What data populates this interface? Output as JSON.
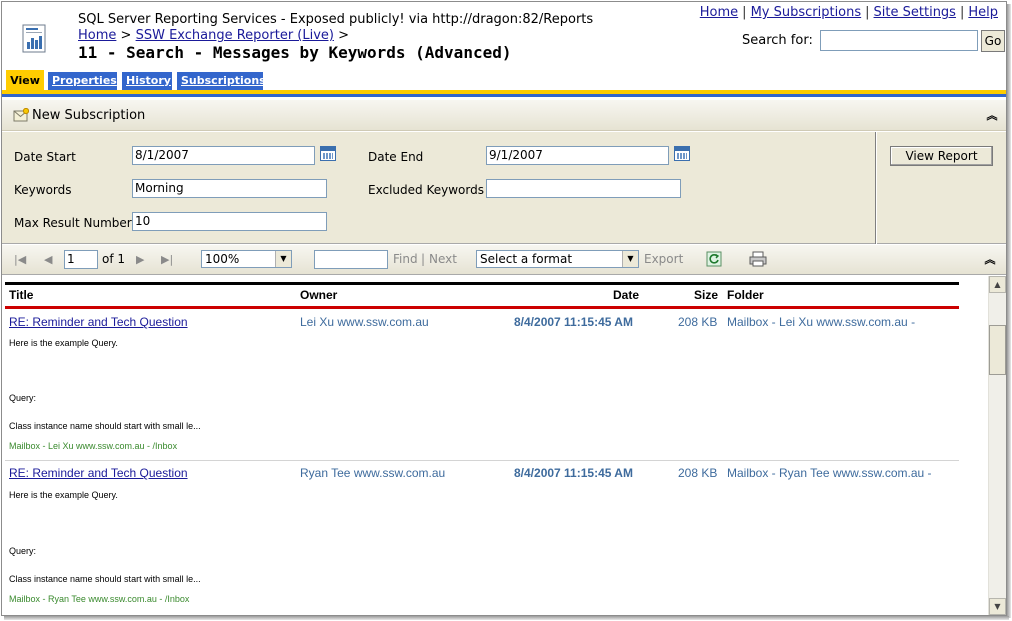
{
  "header": {
    "site_title": "SQL Server Reporting Services - Exposed publicly! via http://dragon:82/Reports",
    "breadcrumb_home": "Home",
    "breadcrumb_sep": ">",
    "breadcrumb_folder": "SSW Exchange Reporter (Live)",
    "breadcrumb_trailing": ">",
    "page_title": "11 - Search - Messages by Keywords (Advanced)",
    "top_links": {
      "home": "Home",
      "my_subscriptions": "My Subscriptions",
      "site_settings": "Site Settings",
      "help": "Help",
      "separator": "|"
    },
    "search_label": "Search for:",
    "search_value": "",
    "go_label": "Go"
  },
  "tabs": [
    {
      "label": "View",
      "active": true
    },
    {
      "label": "Properties",
      "active": false
    },
    {
      "label": "History",
      "active": false
    },
    {
      "label": "Subscriptions",
      "active": false
    }
  ],
  "subscription_bar": {
    "new_subscription_label": "New Subscription",
    "collapse_icon": "double-chevron-up-icon"
  },
  "parameters": {
    "date_start_label": "Date Start",
    "date_start_value": "8/1/2007",
    "date_end_label": "Date End",
    "date_end_value": "9/1/2007",
    "keywords_label": "Keywords",
    "keywords_value": "Morning",
    "excluded_keywords_label": "Excluded Keywords",
    "excluded_keywords_value": "",
    "max_result_label": "Max Result Number",
    "max_result_value": "10",
    "view_report_label": "View Report"
  },
  "toolbar": {
    "page_value": "1",
    "page_of": "of 1",
    "zoom_value": "100%",
    "find_value": "",
    "find_label": "Find",
    "find_separator": "|",
    "next_label": "Next",
    "format_value": "Select a format",
    "export_label": "Export"
  },
  "report": {
    "columns": {
      "title": "Title",
      "owner": "Owner",
      "date": "Date",
      "size": "Size",
      "folder": "Folder"
    },
    "records": [
      {
        "title": "RE: Reminder and Tech Question",
        "owner": "Lei Xu www.ssw.com.au",
        "date": "8/4/2007 11:15:45 AM",
        "size": "208 KB",
        "folder": "Mailbox - Lei Xu www.ssw.com.au -",
        "body_line1": "Here is the example Query.",
        "body_line2": "Query:",
        "body_line3": "Class instance name should start with small le...",
        "path": "Mailbox - Lei Xu www.ssw.com.au - /Inbox"
      },
      {
        "title": "RE: Reminder and Tech Question",
        "owner": "Ryan Tee www.ssw.com.au",
        "date": "8/4/2007 11:15:45 AM",
        "size": "208 KB",
        "folder": "Mailbox - Ryan Tee www.ssw.com.au -",
        "body_line1": "Here is the example Query.",
        "body_line2": "Query:",
        "body_line3": "Class instance name should start with small le...",
        "path": "Mailbox - Ryan Tee www.ssw.com.au - /Inbox"
      }
    ]
  },
  "colors": {
    "tab_active": "#ffcc00",
    "tab_inactive": "#3366cc",
    "link": "#1a1a99",
    "record_text": "#3e6b9d",
    "path_text": "#3a8a2e",
    "header_rule_red": "#cc0000"
  }
}
